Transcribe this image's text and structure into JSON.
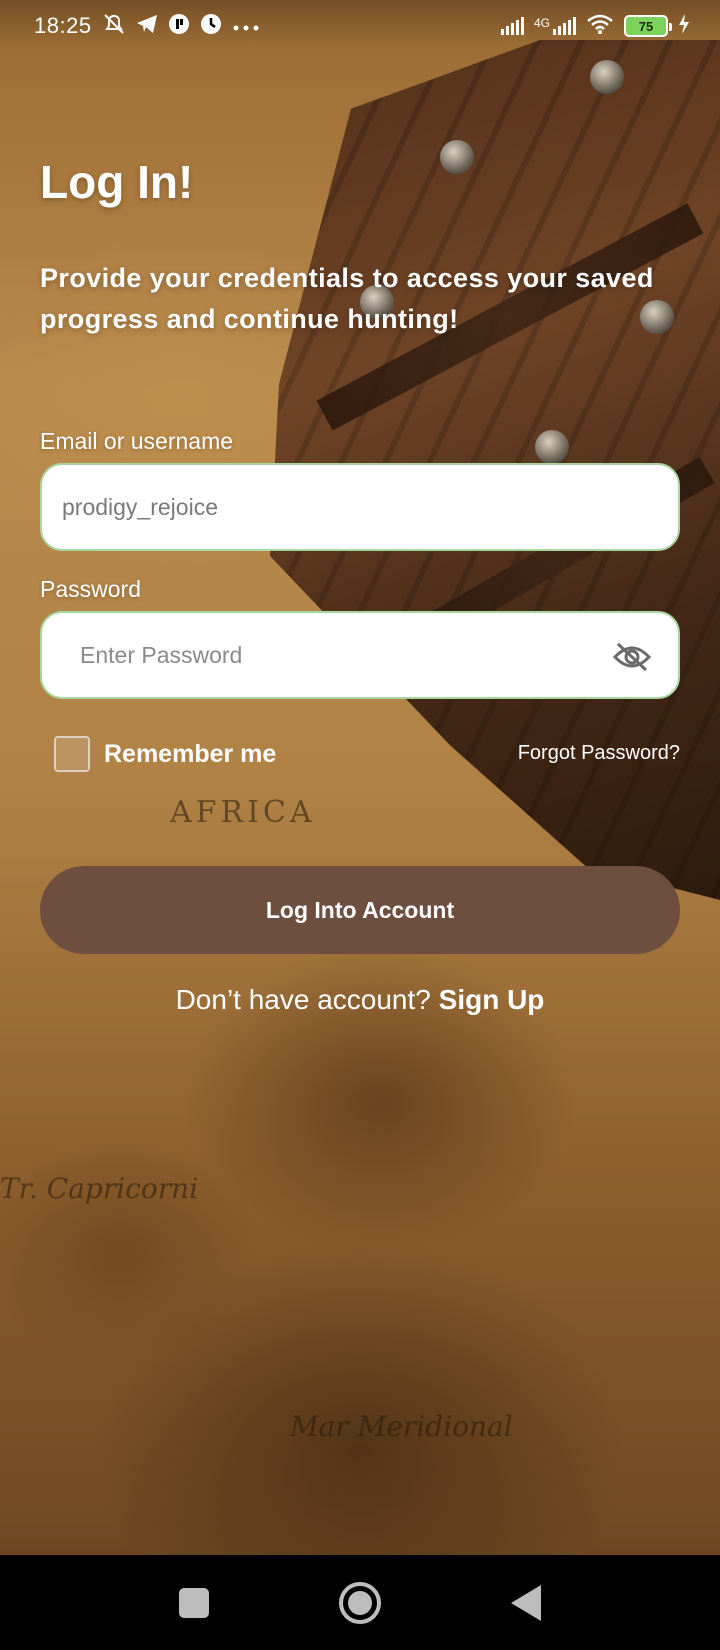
{
  "status_bar": {
    "time": "18:25",
    "network_type": "4G",
    "battery_level": "75",
    "icons": [
      "notifications-off-icon",
      "telegram-icon",
      "app-icon",
      "clock-app-icon",
      "more-dots-icon",
      "signal-icon",
      "signal-4g-icon",
      "wifi-icon",
      "battery-icon",
      "charging-icon"
    ]
  },
  "login": {
    "title": "Log In!",
    "subtitle": "Provide your credentials to access your saved progress and continue hunting!",
    "email_label": "Email or username",
    "email_value": "prodigy_rejoice",
    "password_label": "Password",
    "password_placeholder": "Enter Password",
    "remember_label": "Remember me",
    "remember_checked": false,
    "forgot_label": "Forgot Password?",
    "login_button": "Log Into Account",
    "signup_prompt": "Don’t have account? ",
    "signup_link": "Sign Up"
  },
  "background_map_labels": {
    "africa": "AFRICA",
    "capricorn": "Tr. Capricorni",
    "mar": "Mar Meridional"
  },
  "colors": {
    "primary_button": "#6e4e3f",
    "input_border": "#a8d6a0",
    "text_on_bg": "#ffffff"
  }
}
